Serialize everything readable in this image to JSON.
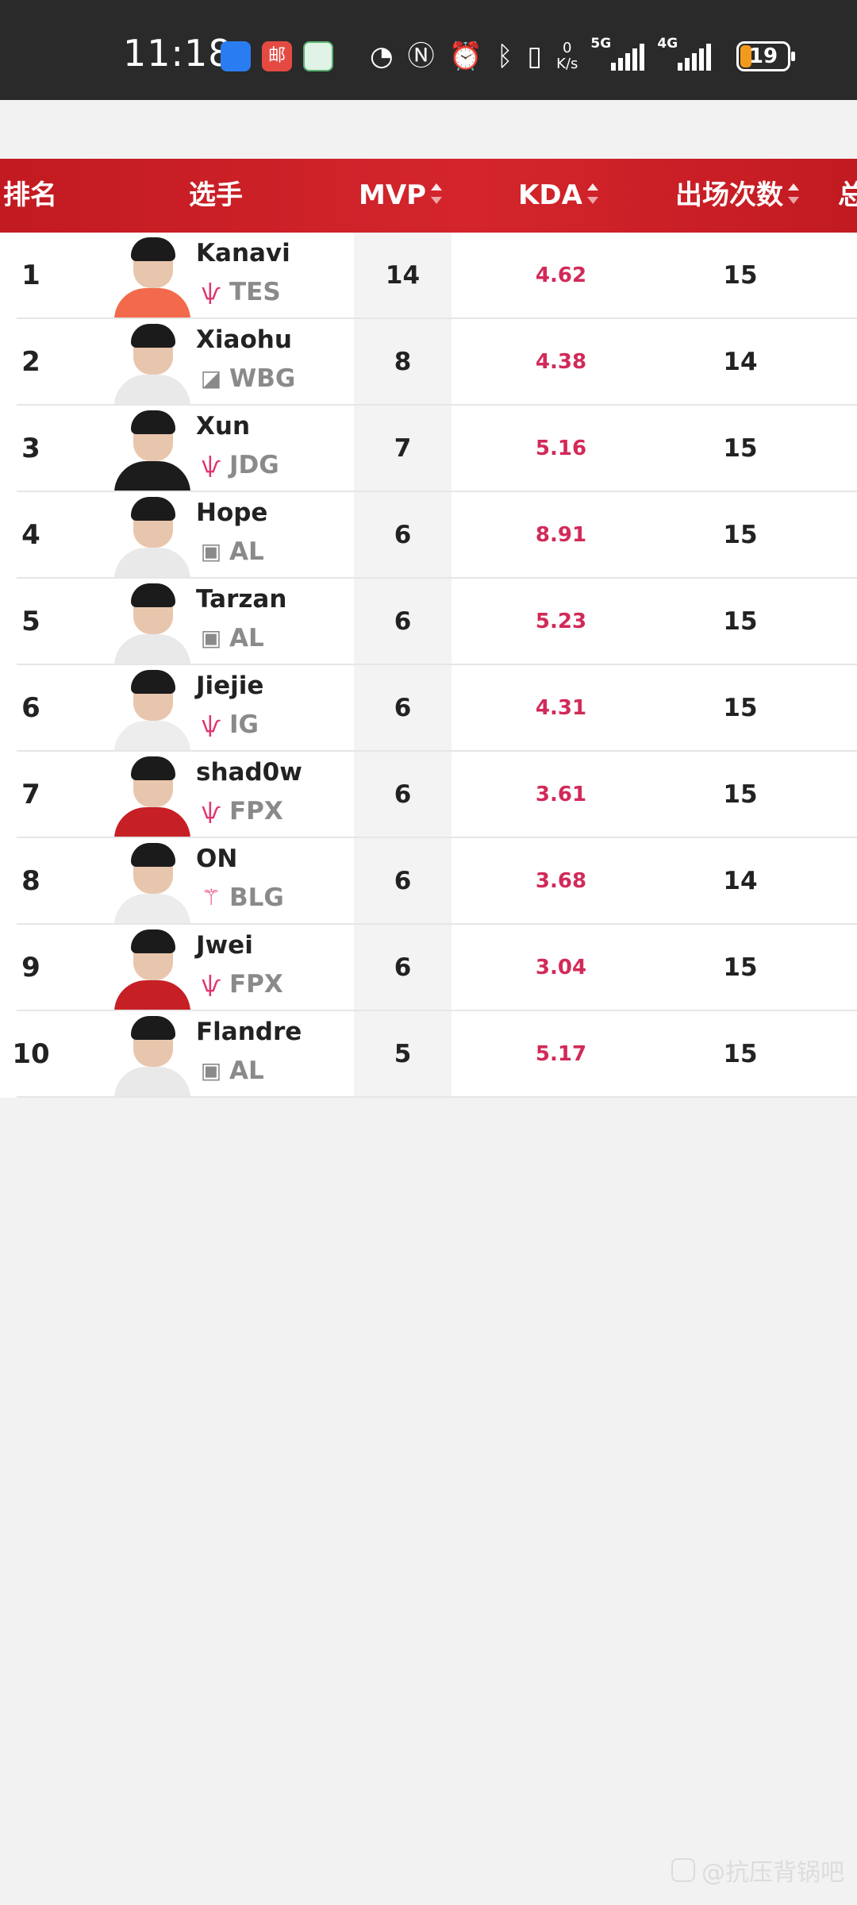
{
  "status_bar": {
    "time": "11:18",
    "net_speed_value": "0",
    "net_speed_unit": "K/s",
    "signal_1": "5G",
    "signal_2": "4G",
    "battery": "19",
    "app_icon_2_glyph": "邮",
    "icons": [
      "shield-app-icon",
      "mail-app-icon",
      "green-app-icon",
      "speedometer-icon",
      "nfc-icon",
      "alarm-icon",
      "bluetooth-icon",
      "vibrate-icon"
    ]
  },
  "table": {
    "headers": {
      "rank": "排名",
      "player": "选手",
      "mvp": "MVP",
      "kda": "KDA",
      "games": "出场次数",
      "extra": "总"
    },
    "rows": [
      {
        "rank": "1",
        "name": "Kanavi",
        "team": "TES",
        "team_logo": "tes-logo-icon",
        "mvp": "14",
        "kda": "4.62",
        "games": "15",
        "jersey": "#f26a4b"
      },
      {
        "rank": "2",
        "name": "Xiaohu",
        "team": "WBG",
        "team_logo": "wbg-logo-icon",
        "mvp": "8",
        "kda": "4.38",
        "games": "14",
        "jersey": "#e9e9e9"
      },
      {
        "rank": "3",
        "name": "Xun",
        "team": "JDG",
        "team_logo": "jdg-logo-icon",
        "mvp": "7",
        "kda": "5.16",
        "games": "15",
        "jersey": "#1c1c1c"
      },
      {
        "rank": "4",
        "name": "Hope",
        "team": "AL",
        "team_logo": "al-logo-icon",
        "mvp": "6",
        "kda": "8.91",
        "games": "15",
        "jersey": "#e9e9e9"
      },
      {
        "rank": "5",
        "name": "Tarzan",
        "team": "AL",
        "team_logo": "al-logo-icon",
        "mvp": "6",
        "kda": "5.23",
        "games": "15",
        "jersey": "#e9e9e9"
      },
      {
        "rank": "6",
        "name": "Jiejie",
        "team": "IG",
        "team_logo": "ig-logo-icon",
        "mvp": "6",
        "kda": "4.31",
        "games": "15",
        "jersey": "#ededed"
      },
      {
        "rank": "7",
        "name": "shad0w",
        "team": "FPX",
        "team_logo": "fpx-logo-icon",
        "mvp": "6",
        "kda": "3.61",
        "games": "15",
        "jersey": "#c62026"
      },
      {
        "rank": "8",
        "name": "ON",
        "team": "BLG",
        "team_logo": "blg-logo-icon",
        "mvp": "6",
        "kda": "3.68",
        "games": "14",
        "jersey": "#ececec"
      },
      {
        "rank": "9",
        "name": "Jwei",
        "team": "FPX",
        "team_logo": "fpx-logo-icon",
        "mvp": "6",
        "kda": "3.04",
        "games": "15",
        "jersey": "#c62026"
      },
      {
        "rank": "10",
        "name": "Flandre",
        "team": "AL",
        "team_logo": "al-logo-icon",
        "mvp": "5",
        "kda": "5.17",
        "games": "15",
        "jersey": "#e9e9e9"
      }
    ]
  },
  "watermark": "@抗压背锅吧",
  "colors": {
    "header_red": "#c21a21",
    "kda_pink": "#d22a58",
    "team_logo_pink": "#e0356b",
    "team_gray": "#8a8a8a"
  }
}
